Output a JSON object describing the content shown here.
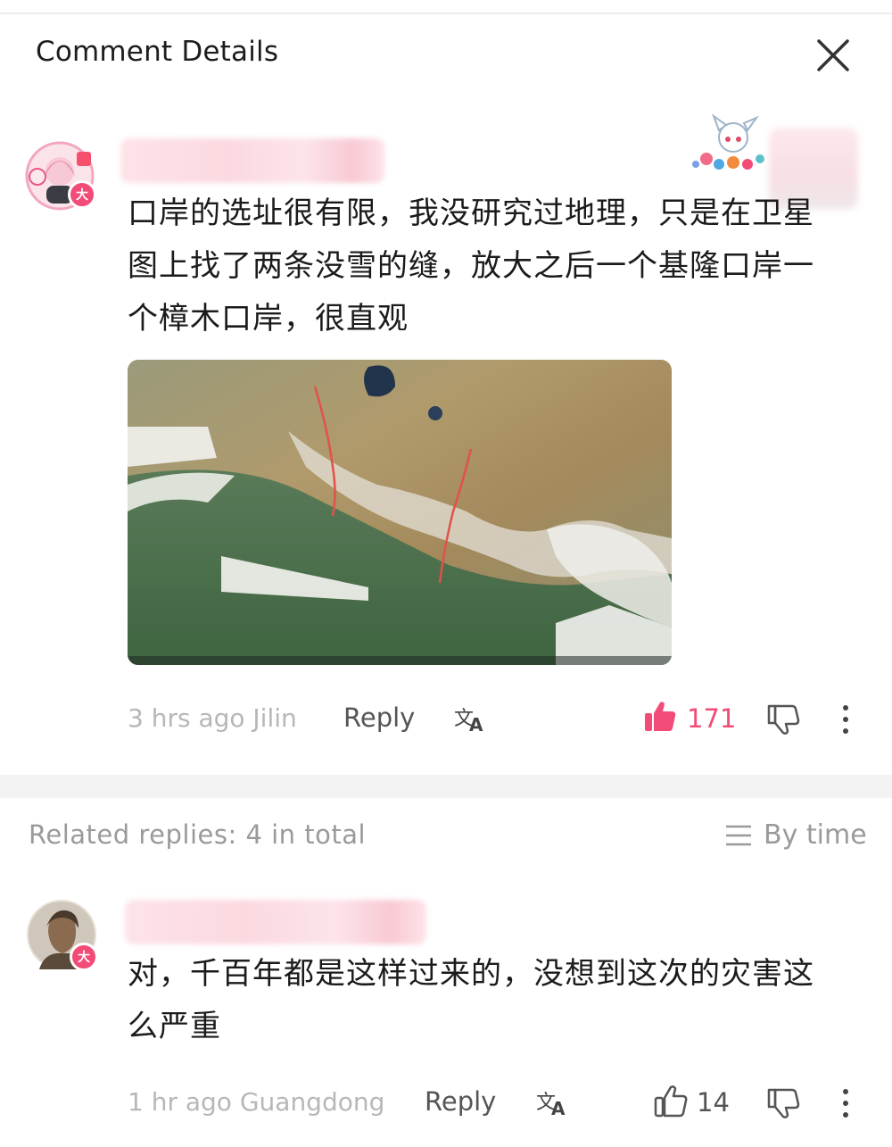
{
  "header": {
    "title": "Comment Details"
  },
  "comment": {
    "text": "口岸的选址很有限，我没研究过地理，只是在卫星图上找了两条没雪的缝，放大之后一个基隆口岸一个樟木口岸，很直观",
    "meta": "3 hrs ago Jilin",
    "reply_label": "Reply",
    "like_count": "171",
    "avatar_badge": "大",
    "liked": true
  },
  "related": {
    "label": "Related replies: 4 in total",
    "sort_label": "By time"
  },
  "reply": {
    "text": "对，千百年都是这样过来的，没想到这次的灾害这么严重",
    "meta": "1 hr ago Guangdong",
    "reply_label": "Reply",
    "like_count": "14",
    "avatar_badge": "大",
    "liked": false
  },
  "colors": {
    "accent": "#f24b78",
    "muted": "#b7b7b7"
  },
  "icons": [
    "close-icon",
    "translate-icon",
    "thumbs-up-icon",
    "thumbs-down-icon",
    "more-icon",
    "sort-list-icon"
  ]
}
